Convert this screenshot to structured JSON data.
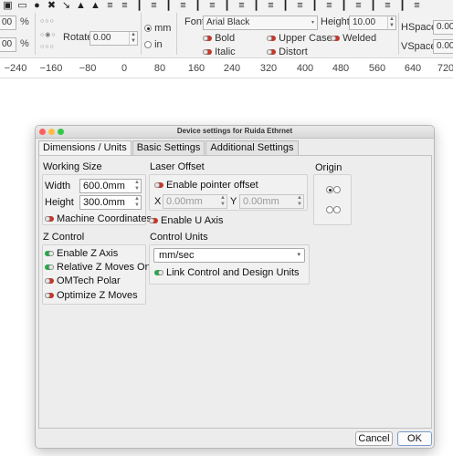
{
  "toolbar": {
    "icons": [
      "camera-icon",
      "monitor-icon",
      "user-icon",
      "tools-icon",
      "arrow-icon",
      "arrow-icon",
      "arrow-icon",
      "align-icon",
      "align-icon",
      "align-icon",
      "align-icon",
      "align-icon",
      "align-icon",
      "align-icon",
      "align-icon",
      "align-icon",
      "align-icon",
      "align-icon",
      "align-icon",
      "align-icon",
      "align-icon",
      "align-icon",
      "align-icon",
      "align-icon",
      "align-icon",
      "align-icon",
      "align-icon",
      "align-icon",
      "align-icon"
    ],
    "field1_value": "00",
    "field2_value": "00",
    "percent": "%",
    "rotate_label": "Rotate",
    "rotate_value": "0.00",
    "unit_mm": "mm",
    "unit_in": "in",
    "font_label": "Font",
    "font_value": "Arial Black",
    "height_label": "Height",
    "height_value": "10.00",
    "bold_label": "Bold",
    "italic_label": "Italic",
    "upper_case_label": "Upper Case",
    "welded_label": "Welded",
    "distort_label": "Distort",
    "hspace_label": "HSpace",
    "hspace_value": "0.00",
    "vspace_label": "VSpace",
    "vspace_value": "0.00"
  },
  "ruler": {
    "ticks": [
      "−240",
      "−160",
      "−80",
      "0",
      "80",
      "160",
      "240",
      "320",
      "400",
      "480",
      "560",
      "640",
      "720"
    ]
  },
  "dialog": {
    "title": "Device settings for Ruida Ethrnet",
    "tabs": [
      "Dimensions / Units",
      "Basic Settings",
      "Additional Settings"
    ],
    "working_size": {
      "title": "Working Size",
      "width_label": "Width",
      "width_value": "600.0mm",
      "height_label": "Height",
      "height_value": "300.0mm",
      "machine_coords_label": "Machine Coordinates"
    },
    "laser_offset": {
      "title": "Laser Offset",
      "enable_pointer_label": "Enable pointer offset",
      "x_label": "X",
      "x_value": "0.00mm",
      "y_label": "Y",
      "y_value": "0.00mm",
      "enable_u_axis_label": "Enable U Axis"
    },
    "origin": {
      "title": "Origin"
    },
    "z_control": {
      "title": "Z Control",
      "enable_z_label": "Enable Z Axis",
      "relative_z_label": "Relative Z Moves Only",
      "omtech_label": "OMTech Polar",
      "optimize_z_label": "Optimize Z Moves"
    },
    "control_units": {
      "title": "Control Units",
      "selected": "mm/sec",
      "link_units_label": "Link Control and Design Units"
    },
    "cancel_label": "Cancel",
    "ok_label": "OK"
  },
  "colors": {
    "toggle_off": "#c0392b",
    "toggle_on": "#2aa44a"
  }
}
